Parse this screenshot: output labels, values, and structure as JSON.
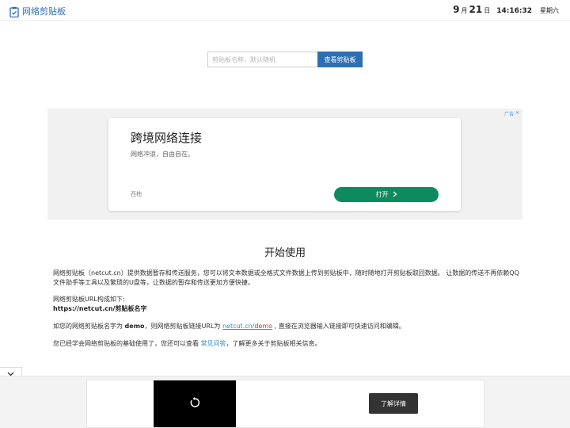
{
  "header": {
    "site_name": "网络剪贴板",
    "date_month": "9",
    "month_label": "月",
    "date_day": "21",
    "day_label": "日",
    "time": "14:16:32",
    "weekday": "星期六"
  },
  "search": {
    "placeholder": "剪贴板名称，默认随机",
    "button_label": "查看剪贴板"
  },
  "ad": {
    "mark": "广告",
    "close": "✕",
    "title": "跨境网络连接",
    "subtitle": "网络冲浪，自由自在。",
    "brand": "西柚",
    "open_label": "打开"
  },
  "content": {
    "heading": "开始使用",
    "intro": "网络剪贴板（netcut.cn）提供数据暂存和传送服务，您可以将文本数据或全格式文件数据上传到剪贴板中，随时随地打开剪贴板取回数据。 让数据的传送不再依赖QQ文件助手等工具以及繁琐的U盘等，让数据的暂存和传送更加方便快捷。",
    "url_intro": "网络剪贴板URL构成如下:",
    "url_pattern": "https://netcut.cn/剪贴板名字",
    "example_prefix": "如您的网络剪贴板名字为 ",
    "example_name": "demo",
    "example_mid": "，则网络剪贴板链接URL为 ",
    "example_link_host": "netcut.cn/",
    "example_link_path": "demo",
    "example_suffix": " , 直接在浏览器输入链接即可快速访问和编辑。",
    "faq_prefix": "您已经学会网络剪贴板的基础使用了，您还可以查看 ",
    "faq_link": "常见问答",
    "faq_suffix": "，了解更多关于剪贴板相关信息。"
  },
  "bottom_ad": {
    "learn_more": "了解详情"
  },
  "colors": {
    "brand_blue": "#2d6fb3",
    "ad_green": "#0e8a5f",
    "link": "#2a8dd4"
  }
}
